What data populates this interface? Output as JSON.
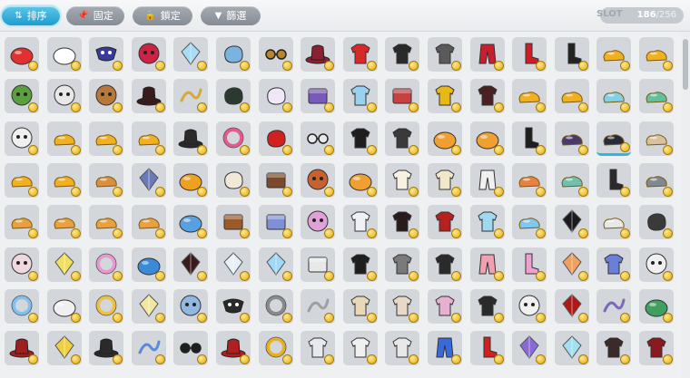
{
  "toolbar": {
    "buttons": [
      {
        "label": "排序",
        "icon": "sort-icon",
        "glyph": "⇅",
        "active": true
      },
      {
        "label": "固定",
        "icon": "pin-icon",
        "glyph": "📌",
        "active": false
      },
      {
        "label": "鎖定",
        "icon": "lock-icon",
        "glyph": "🔒",
        "active": false
      },
      {
        "label": "篩選",
        "icon": "filter-icon",
        "glyph": "▼",
        "active": false
      }
    ]
  },
  "slot": {
    "label": "SLOT",
    "used": "186",
    "separator": "/",
    "max": "256"
  },
  "colors": {
    "accent": "#1e9ccd",
    "slot_bg": "#d3d6da",
    "coin": "#e0a910"
  },
  "inventory": {
    "selected_index": 46,
    "rows": [
      [
        {
          "icon": "bowl-icon",
          "shape": "dome",
          "color": "#e03030"
        },
        {
          "icon": "cap-icon",
          "shape": "dome",
          "color": "#ffffff"
        },
        {
          "icon": "bat-mask-icon",
          "shape": "mask",
          "color": "#3a3a9a"
        },
        {
          "icon": "vampire-face-icon",
          "shape": "face",
          "color": "#cc2244"
        },
        {
          "icon": "ice-crystal-icon",
          "shape": "crystal",
          "color": "#a6dcf5"
        },
        {
          "icon": "fish-icon",
          "shape": "blob",
          "color": "#7ab3e0"
        },
        {
          "icon": "glasses-icon",
          "shape": "glasses",
          "color": "#b8862a"
        },
        {
          "icon": "red-hat-icon",
          "shape": "hat",
          "color": "#8a2030"
        },
        {
          "icon": "red-top-icon",
          "shape": "shirt",
          "color": "#d82828"
        },
        {
          "icon": "black-coat-icon",
          "shape": "shirt",
          "color": "#2a2a2a"
        },
        {
          "icon": "armor-icon",
          "shape": "shirt",
          "color": "#5a5a5a"
        },
        {
          "icon": "red-pants-icon",
          "shape": "pants",
          "color": "#c81e2e"
        },
        {
          "icon": "red-boots-icon",
          "shape": "boot",
          "color": "#d01c24"
        },
        {
          "icon": "black-boots-icon",
          "shape": "boot",
          "color": "#222222"
        },
        {
          "icon": "gold-shoes-icon",
          "shape": "shoe",
          "color": "#f0b020"
        },
        {
          "icon": "gold-shoes-icon",
          "shape": "shoe",
          "color": "#f0b020"
        }
      ],
      [
        {
          "icon": "zombie-face-icon",
          "shape": "face",
          "color": "#5aa040"
        },
        {
          "icon": "skull-hood-icon",
          "shape": "face",
          "color": "#e8e8e8"
        },
        {
          "icon": "fox-face-icon",
          "shape": "face",
          "color": "#b87838"
        },
        {
          "icon": "dark-hood-icon",
          "shape": "hat",
          "color": "#3a1a1a"
        },
        {
          "icon": "gold-chain-icon",
          "shape": "chain",
          "color": "#d8a838"
        },
        {
          "icon": "black-cat-icon",
          "shape": "blob",
          "color": "#2a3a30"
        },
        {
          "icon": "bunny-icon",
          "shape": "blob",
          "color": "#f0e8f8"
        },
        {
          "icon": "purple-box-icon",
          "shape": "box",
          "color": "#7a5ab8"
        },
        {
          "icon": "blue-shirt-icon",
          "shape": "shirt",
          "color": "#9ad0f0"
        },
        {
          "icon": "red-gift-icon",
          "shape": "box",
          "color": "#c84040"
        },
        {
          "icon": "yellow-dress-icon",
          "shape": "shirt",
          "color": "#e8b818"
        },
        {
          "icon": "dark-robe-icon",
          "shape": "shirt",
          "color": "#4a2020"
        },
        {
          "icon": "gold-shoes-icon",
          "shape": "shoe",
          "color": "#f0b020"
        },
        {
          "icon": "gold-shoes-icon",
          "shape": "shoe",
          "color": "#f0b020"
        },
        {
          "icon": "blue-slipper-icon",
          "shape": "shoe",
          "color": "#80d0e8"
        },
        {
          "icon": "teal-shoe-icon",
          "shape": "shoe",
          "color": "#60c0a0"
        }
      ],
      [
        {
          "icon": "skull-icon",
          "shape": "face",
          "color": "#f0f0f0"
        },
        {
          "icon": "gold-shoes-icon",
          "shape": "shoe",
          "color": "#f0b020"
        },
        {
          "icon": "gold-shoes-icon",
          "shape": "shoe",
          "color": "#f0b020"
        },
        {
          "icon": "gold-shoes-icon",
          "shape": "shoe",
          "color": "#f0b020"
        },
        {
          "icon": "top-hat-icon",
          "shape": "hat",
          "color": "#2a2a2a"
        },
        {
          "icon": "pink-ring-icon",
          "shape": "ring",
          "color": "#e85890"
        },
        {
          "icon": "red-flower-icon",
          "shape": "blob",
          "color": "#d02020"
        },
        {
          "icon": "white-eyes-icon",
          "shape": "glasses",
          "color": "#e8e8e8"
        },
        {
          "icon": "black-jacket-icon",
          "shape": "shirt",
          "color": "#1e1e1e"
        },
        {
          "icon": "striped-coat-icon",
          "shape": "shirt",
          "color": "#3a3a3a"
        },
        {
          "icon": "orange-bun-icon",
          "shape": "dome",
          "color": "#f0a030"
        },
        {
          "icon": "orange-bun-icon",
          "shape": "dome",
          "color": "#f0a030"
        },
        {
          "icon": "black-boot-icon",
          "shape": "boot",
          "color": "#1e1e1e"
        },
        {
          "icon": "purple-shoe-icon",
          "shape": "shoe",
          "color": "#4a3a6a"
        },
        {
          "icon": "ninja-shoe-icon",
          "shape": "shoe",
          "color": "#2a2a3a"
        },
        {
          "icon": "beige-shoe-icon",
          "shape": "shoe",
          "color": "#d8c0a0"
        }
      ],
      [
        {
          "icon": "gold-shoes-icon",
          "shape": "shoe",
          "color": "#f0b020"
        },
        {
          "icon": "gold-shoes-icon",
          "shape": "shoe",
          "color": "#f0b020"
        },
        {
          "icon": "bear-shoes-icon",
          "shape": "shoe",
          "color": "#d89040"
        },
        {
          "icon": "sword-icon",
          "shape": "crystal",
          "color": "#6a7ab8"
        },
        {
          "icon": "mushroom-icon",
          "shape": "dome",
          "color": "#f0a020"
        },
        {
          "icon": "seal-icon",
          "shape": "blob",
          "color": "#f0e8d8"
        },
        {
          "icon": "brown-box-icon",
          "shape": "box",
          "color": "#7a4a2a"
        },
        {
          "icon": "pirate-face-icon",
          "shape": "face",
          "color": "#c86030"
        },
        {
          "icon": "orange-bun-icon",
          "shape": "dome",
          "color": "#f0a030"
        },
        {
          "icon": "white-blouse-icon",
          "shape": "shirt",
          "color": "#f8f0e0"
        },
        {
          "icon": "cream-shirt-icon",
          "shape": "shirt",
          "color": "#f0e8c8"
        },
        {
          "icon": "white-skirt-icon",
          "shape": "pants",
          "color": "#f0f0f0"
        },
        {
          "icon": "orange-sneaker-icon",
          "shape": "shoe",
          "color": "#e88040"
        },
        {
          "icon": "teal-sneaker-icon",
          "shape": "shoe",
          "color": "#70c0b0"
        },
        {
          "icon": "ninja-boot-icon",
          "shape": "boot",
          "color": "#2a2a2a"
        },
        {
          "icon": "grey-shoe-icon",
          "shape": "shoe",
          "color": "#808890"
        }
      ],
      [
        {
          "icon": "bear-shoes-icon",
          "shape": "shoe",
          "color": "#e8a040"
        },
        {
          "icon": "bear-shoes-icon",
          "shape": "shoe",
          "color": "#e8a040"
        },
        {
          "icon": "bear-shoes-icon",
          "shape": "shoe",
          "color": "#e8a040"
        },
        {
          "icon": "bear-shoes-icon",
          "shape": "shoe",
          "color": "#e8a040"
        },
        {
          "icon": "blue-helmet-icon",
          "shape": "dome",
          "color": "#5aa0e0"
        },
        {
          "icon": "brown-crown-icon",
          "shape": "box",
          "color": "#9a5a2a"
        },
        {
          "icon": "blue-crown-icon",
          "shape": "box",
          "color": "#8090d8"
        },
        {
          "icon": "pink-bear-icon",
          "shape": "face",
          "color": "#e0a0d8"
        },
        {
          "icon": "white-sweater-icon",
          "shape": "shirt",
          "color": "#f0f0f8"
        },
        {
          "icon": "black-red-coat-icon",
          "shape": "shirt",
          "color": "#2a1a1a"
        },
        {
          "icon": "red-dress-icon",
          "shape": "shirt",
          "color": "#b82020"
        },
        {
          "icon": "blue-baby-icon",
          "shape": "shirt",
          "color": "#a0d8f0"
        },
        {
          "icon": "blue-sneaker-icon",
          "shape": "shoe",
          "color": "#80c8f0"
        },
        {
          "icon": "black-feather-icon",
          "shape": "crystal",
          "color": "#1a1a1a"
        },
        {
          "icon": "white-shoe-icon",
          "shape": "shoe",
          "color": "#e8e8e8"
        },
        {
          "icon": "skeleton-glove-icon",
          "shape": "blob",
          "color": "#3a3a3a"
        }
      ],
      [
        {
          "icon": "pink-bear-hat-icon",
          "shape": "face",
          "color": "#f0d8e0"
        },
        {
          "icon": "yellow-sparkle-icon",
          "shape": "crystal",
          "color": "#f0e060"
        },
        {
          "icon": "pink-ears-icon",
          "shape": "ring",
          "color": "#e898d0"
        },
        {
          "icon": "blue-bowl-icon",
          "shape": "dome",
          "color": "#3a8ad8"
        },
        {
          "icon": "dark-wing-icon",
          "shape": "crystal",
          "color": "#3a1a1a"
        },
        {
          "icon": "white-stars-icon",
          "shape": "crystal",
          "color": "#e8f0f8"
        },
        {
          "icon": "ice-wing-icon",
          "shape": "crystal",
          "color": "#a0d8f8"
        },
        {
          "icon": "washer-icon",
          "shape": "box",
          "color": "#e8e8e8"
        },
        {
          "icon": "black-suit-icon",
          "shape": "shirt",
          "color": "#1e1e1e"
        },
        {
          "icon": "grey-coat-icon",
          "shape": "shirt",
          "color": "#7a7a7a"
        },
        {
          "icon": "dark-cape-icon",
          "shape": "shirt",
          "color": "#2a2a2a"
        },
        {
          "icon": "pink-skirt-icon",
          "shape": "pants",
          "color": "#f0a0b0"
        },
        {
          "icon": "pink-sock-icon",
          "shape": "boot",
          "color": "#f0a0d0"
        },
        {
          "icon": "flame-icon",
          "shape": "crystal",
          "color": "#f0a060"
        },
        {
          "icon": "blue-robe-icon",
          "shape": "shirt",
          "color": "#6a80d8"
        },
        {
          "icon": "baseball-icon",
          "shape": "face",
          "color": "#f0f0f0"
        }
      ],
      [
        {
          "icon": "blue-hearts-icon",
          "shape": "ring",
          "color": "#80c0f0"
        },
        {
          "icon": "white-egg-icon",
          "shape": "dome",
          "color": "#f0f0f0"
        },
        {
          "icon": "gold-swirl-icon",
          "shape": "ring",
          "color": "#f0c040"
        },
        {
          "icon": "sparkle-box-icon",
          "shape": "crystal",
          "color": "#f0e8a0"
        },
        {
          "icon": "blue-skull-icon",
          "shape": "face",
          "color": "#90b8e0"
        },
        {
          "icon": "black-mask-icon",
          "shape": "mask",
          "color": "#2a2a2a"
        },
        {
          "icon": "bubble-icon",
          "shape": "ring",
          "color": "#8a8a8a"
        },
        {
          "icon": "hanger-icon",
          "shape": "chain",
          "color": "#a0a0a0"
        },
        {
          "icon": "beige-jacket-icon",
          "shape": "shirt",
          "color": "#e8d8b8"
        },
        {
          "icon": "nurse-outfit-icon",
          "shape": "shirt",
          "color": "#e8d8c8"
        },
        {
          "icon": "pink-dress-icon",
          "shape": "shirt",
          "color": "#e8b0d0"
        },
        {
          "icon": "black-gown-icon",
          "shape": "shirt",
          "color": "#2a2a2a"
        },
        {
          "icon": "baseball-icon",
          "shape": "face",
          "color": "#f0f0f0"
        },
        {
          "icon": "red-wing-icon",
          "shape": "crystal",
          "color": "#b01818"
        },
        {
          "icon": "purple-hook-icon",
          "shape": "chain",
          "color": "#7a6ab8"
        },
        {
          "icon": "green-umbrella-icon",
          "shape": "dome",
          "color": "#40a060"
        }
      ],
      [
        {
          "icon": "red-helmet-icon",
          "shape": "hat",
          "color": "#a02020"
        },
        {
          "icon": "yellow-star-icon",
          "shape": "crystal",
          "color": "#f0d040"
        },
        {
          "icon": "pirate-hat-icon",
          "shape": "hat",
          "color": "#2a2a2a"
        },
        {
          "icon": "blue-key-icon",
          "shape": "chain",
          "color": "#5a8ad8"
        },
        {
          "icon": "sunglasses-icon",
          "shape": "glasses",
          "color": "#1e1e1e"
        },
        {
          "icon": "red-beret-icon",
          "shape": "hat",
          "color": "#b02020"
        },
        {
          "icon": "gold-ring-icon",
          "shape": "ring",
          "color": "#e8b020"
        },
        {
          "icon": "jersey-icon",
          "shape": "shirt",
          "color": "#e8e8f0"
        },
        {
          "icon": "white-shirt-icon",
          "shape": "shirt",
          "color": "#f0f0f0"
        },
        {
          "icon": "ghost-shirt-icon",
          "shape": "shirt",
          "color": "#e8e8e8"
        },
        {
          "icon": "blue-shorts-icon",
          "shape": "pants",
          "color": "#3a6ad8"
        },
        {
          "icon": "red-boot-icon",
          "shape": "boot",
          "color": "#d02020"
        },
        {
          "icon": "purple-crystal-icon",
          "shape": "crystal",
          "color": "#8a6ad8"
        },
        {
          "icon": "ice-gem-icon",
          "shape": "crystal",
          "color": "#a0e0f0"
        },
        {
          "icon": "fur-coat-icon",
          "shape": "shirt",
          "color": "#3a2a2a"
        },
        {
          "icon": "red-cape-icon",
          "shape": "shirt",
          "color": "#8a1a20"
        }
      ]
    ]
  }
}
